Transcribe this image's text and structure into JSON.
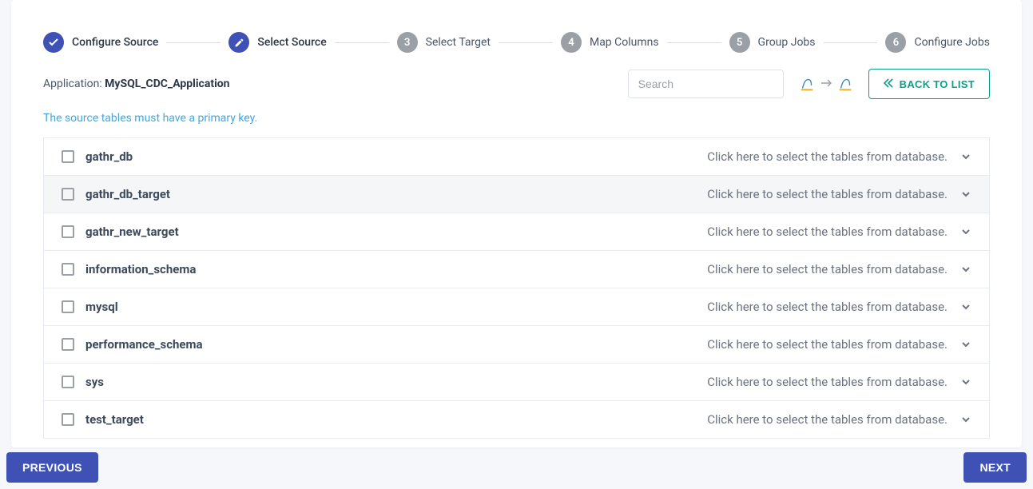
{
  "stepper": {
    "steps": [
      {
        "label": "Configure Source",
        "state": "done",
        "content": "check"
      },
      {
        "label": "Select Source",
        "state": "active",
        "content": "pencil"
      },
      {
        "label": "Select Target",
        "state": "pending",
        "content": "3"
      },
      {
        "label": "Map Columns",
        "state": "pending",
        "content": "4"
      },
      {
        "label": "Group Jobs",
        "state": "pending",
        "content": "5"
      },
      {
        "label": "Configure Jobs",
        "state": "pending",
        "content": "6"
      }
    ]
  },
  "header": {
    "application_prefix": "Application: ",
    "application_name": "MySQL_CDC_Application",
    "search_placeholder": "Search",
    "back_label": "BACK TO LIST",
    "source_type": "mysql",
    "target_type": "mysql"
  },
  "info_text": "The source tables must have a primary key.",
  "hint_text": "Click here to select the tables from database.",
  "databases": [
    {
      "name": "gathr_db"
    },
    {
      "name": "gathr_db_target",
      "hover": true
    },
    {
      "name": "gathr_new_target"
    },
    {
      "name": "information_schema"
    },
    {
      "name": "mysql"
    },
    {
      "name": "performance_schema"
    },
    {
      "name": "sys"
    },
    {
      "name": "test_target"
    }
  ],
  "footer": {
    "prev": "PREVIOUS",
    "next": "NEXT"
  }
}
